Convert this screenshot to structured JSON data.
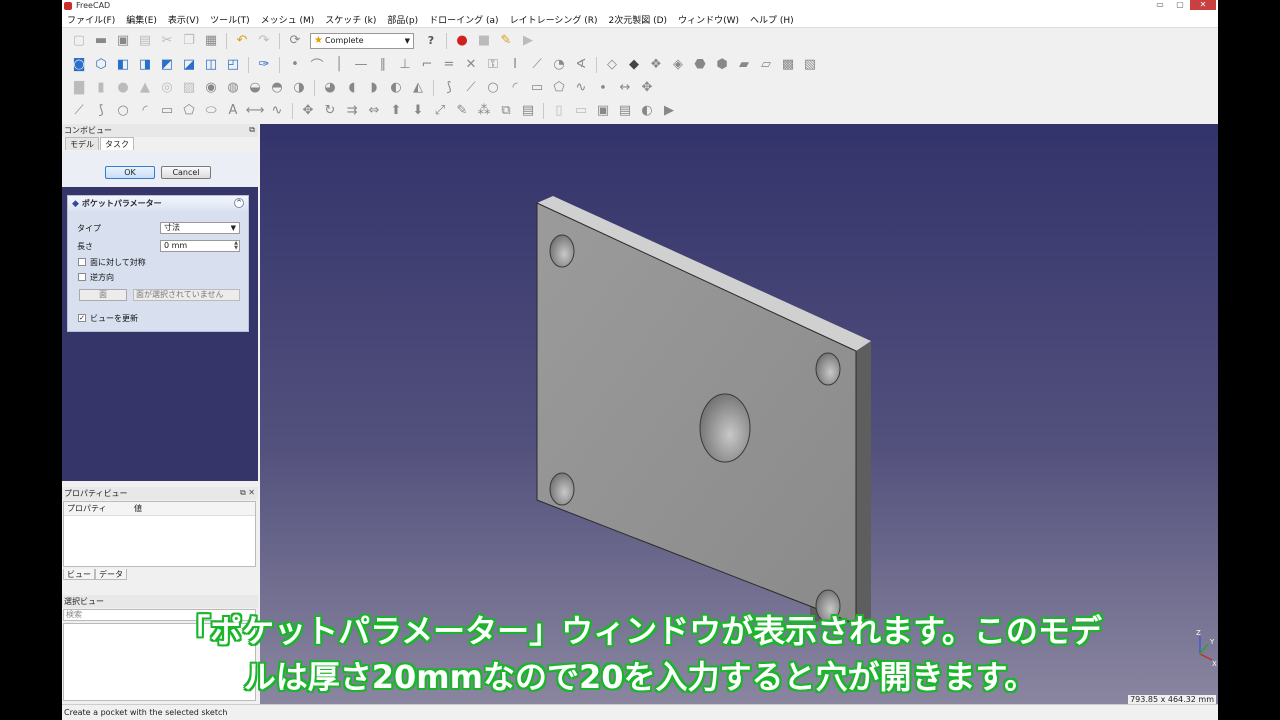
{
  "window": {
    "title": "FreeCAD",
    "buttons": {
      "minimize": "▭",
      "maximize": "▢",
      "close": "✕"
    }
  },
  "menubar": [
    "ファイル(F)",
    "編集(E)",
    "表示(V)",
    "ツール(T)",
    "メッシュ (M)",
    "スケッチ (k)",
    "部品(p)",
    "ドローイング (a)",
    "レイトレーシング (R)",
    "2次元製図 (D)",
    "ウィンドウ(W)",
    "ヘルプ (H)"
  ],
  "toolbar": {
    "workbench": "Complete",
    "help_icon": "?"
  },
  "combo_view": {
    "title": "コンボビュー",
    "tabs": [
      "モデル",
      "タスク"
    ],
    "active_tab": "タスク",
    "ok_label": "OK",
    "cancel_label": "Cancel",
    "panel": {
      "title": "ポケットパラメーター",
      "type_label": "タイプ",
      "type_value": "寸法",
      "length_label": "長さ",
      "length_value": "0 mm",
      "symmetric_label": "面に対して対称",
      "symmetric_checked": false,
      "reversed_label": "逆方向",
      "reversed_checked": false,
      "face_button": "面",
      "face_value": "面が選択されていません",
      "update_view_label": "ビューを更新",
      "update_view_checked": true
    }
  },
  "property_view": {
    "title": "プロパティビュー",
    "columns": [
      "プロパティ",
      "値"
    ],
    "tabs": [
      "ビュー",
      "データ"
    ]
  },
  "selection_view": {
    "title": "選択ビュー",
    "search_placeholder": "検索"
  },
  "viewport": {
    "dimensions": "793.85 x 464.32 mm",
    "axis_labels": [
      "Z",
      "Y",
      "X"
    ]
  },
  "statusbar": {
    "message": "Create a pocket with the selected sketch"
  },
  "subtitle": {
    "line1": "「ポケットパラメーター」ウィンドウが表示されます。このモデ",
    "line2": "ルは厚さ20mmなので20を入力すると穴が開きます。"
  },
  "colors": {
    "viewport_top": "#33336b",
    "viewport_bottom": "#8a86a0",
    "subtitle_outline": "#1bb52b",
    "task_panel_bg": "#35356a"
  }
}
